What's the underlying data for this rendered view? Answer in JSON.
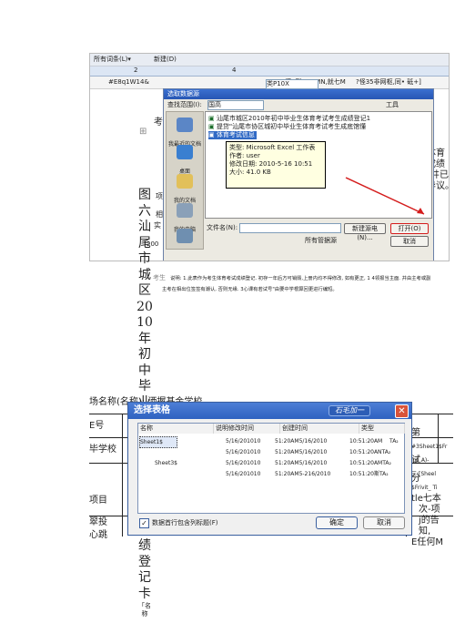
{
  "word_window": {
    "menu_items": [
      "所有词条(L)▾",
      "新建(D)"
    ],
    "doc_tab": "#E8q1W14&",
    "ruler_numbers": [
      "2",
      "4"
    ],
    "row3_left": "懂1到WE_MN,就七M",
    "row3_right": "?怪35非网枢,同• 砥+]",
    "heading_fragment": "考",
    "right_text": [
      "体育",
      "成绩",
      "井已",
      "异议。"
    ],
    "bottom_left": "项",
    "bottom_mid": "相",
    "bottom_num": "200",
    "bottom_frag": "实"
  },
  "open_dialog": {
    "title": "选取数据源",
    "lookin_label": "查找范围(I):",
    "lookin_value": "国高",
    "toolbar_item": "工具",
    "dropdown_item": "类P10X",
    "files": [
      "汕尾市城区2010年初中毕业生体育考试考生成绩登记1",
      "提贷\"汕尾市协区城初中毕业生体育考试考生成底馆懂",
      "体育考试信息"
    ],
    "tooltip": {
      "type": "类型: Microsoft Excel 工作表",
      "author": "作者: user",
      "modified": "修改日期: 2010-5-16 10:51",
      "size": "大小: 41.0 KB"
    },
    "places": [
      "我最近的文档",
      "桌面",
      "我的文档",
      "我的电脑",
      ""
    ],
    "filename_label": "文件名(N):",
    "filetype_value": "所有管据源",
    "new_source": "新建源电(N)...",
    "open_button": "打开(O)",
    "cancel_button": "取消",
    "bottom_tools": "工具"
  },
  "note": {
    "label": "考生",
    "line1": "说明: 1.此表作为考生体育考试成绩登记. 初存一年后方可销毁,上册内均不得修改, 如有更正, 1 4领报当主面. 并由主考或副",
    "line2": "主考在相出位签签有潮认, 否则无缘. 3心课有若试号\"由要中学根算回更进行编短。"
  },
  "vertical_title": [
    "图",
    "六",
    "汕",
    "尾",
    "市",
    "城",
    "区",
    "20",
    "10",
    "年",
    "初",
    "中",
    "毕",
    "业",
    "生",
    "体",
    "育",
    "考",
    "试",
    "考",
    "生",
    "成",
    "绩",
    "登",
    "记",
    "卡",
    "「名",
    "称"
  ],
  "form": {
    "field1": "场名称(名称): 洒握基金学校",
    "field2": "E号",
    "field3": "毕学校",
    "field4": "项目",
    "field5": "翠投",
    "field6": "心跳",
    "right_texts": [
      "#3Sheet1$Fr",
      "int_A)-",
      "三:[Sheel",
      "$Frivit_ Ti",
      "tle七本",
      "次-项",
      "j的告",
      "知,",
      "E任何M"
    ],
    "right_marks": [
      "第",
      "试",
      "分"
    ]
  },
  "select_table": {
    "title": "选择表格",
    "title_badge": "石毛加一",
    "columns": [
      "名称",
      "说明修改时间",
      "创建时间",
      "类型"
    ],
    "rows": [
      {
        "name": "Sheet1$",
        "modified": "5/16/201010",
        "desc": "51:20AM5/16/2010",
        "created": "10:51:20AM",
        "type": "TA₂"
      },
      {
        "name": "",
        "modified": "5/16/201010",
        "desc": "51:20AM5/16/2010",
        "created": "10:51:20ANTA₂",
        "type": ""
      },
      {
        "name": "Sheet3$",
        "modified": "5/16/201010",
        "desc": "51:20AM5/16/2010",
        "created": "10:51:20AMTA₂",
        "type": ""
      },
      {
        "name": "",
        "modified": "5/16/201010",
        "desc": "51:20AM5-216/2010",
        "created": "10:51:20斯TA₂",
        "type": ""
      }
    ],
    "checkbox_label": "数据首行包含列标题(F)",
    "ok_button": "确定",
    "cancel_button": "取消"
  }
}
